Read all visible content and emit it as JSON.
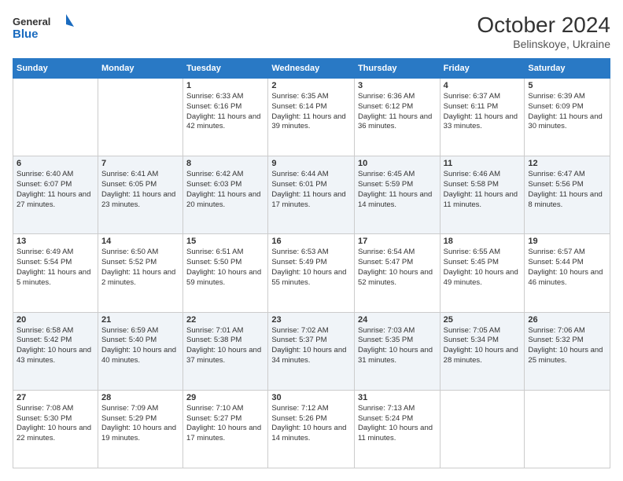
{
  "logo": {
    "general": "General",
    "blue": "Blue"
  },
  "header": {
    "month_year": "October 2024",
    "location": "Belinskoye, Ukraine"
  },
  "days_of_week": [
    "Sunday",
    "Monday",
    "Tuesday",
    "Wednesday",
    "Thursday",
    "Friday",
    "Saturday"
  ],
  "weeks": [
    [
      {
        "day": "",
        "sunrise": "",
        "sunset": "",
        "daylight": ""
      },
      {
        "day": "",
        "sunrise": "",
        "sunset": "",
        "daylight": ""
      },
      {
        "day": "1",
        "sunrise": "Sunrise: 6:33 AM",
        "sunset": "Sunset: 6:16 PM",
        "daylight": "Daylight: 11 hours and 42 minutes."
      },
      {
        "day": "2",
        "sunrise": "Sunrise: 6:35 AM",
        "sunset": "Sunset: 6:14 PM",
        "daylight": "Daylight: 11 hours and 39 minutes."
      },
      {
        "day": "3",
        "sunrise": "Sunrise: 6:36 AM",
        "sunset": "Sunset: 6:12 PM",
        "daylight": "Daylight: 11 hours and 36 minutes."
      },
      {
        "day": "4",
        "sunrise": "Sunrise: 6:37 AM",
        "sunset": "Sunset: 6:11 PM",
        "daylight": "Daylight: 11 hours and 33 minutes."
      },
      {
        "day": "5",
        "sunrise": "Sunrise: 6:39 AM",
        "sunset": "Sunset: 6:09 PM",
        "daylight": "Daylight: 11 hours and 30 minutes."
      }
    ],
    [
      {
        "day": "6",
        "sunrise": "Sunrise: 6:40 AM",
        "sunset": "Sunset: 6:07 PM",
        "daylight": "Daylight: 11 hours and 27 minutes."
      },
      {
        "day": "7",
        "sunrise": "Sunrise: 6:41 AM",
        "sunset": "Sunset: 6:05 PM",
        "daylight": "Daylight: 11 hours and 23 minutes."
      },
      {
        "day": "8",
        "sunrise": "Sunrise: 6:42 AM",
        "sunset": "Sunset: 6:03 PM",
        "daylight": "Daylight: 11 hours and 20 minutes."
      },
      {
        "day": "9",
        "sunrise": "Sunrise: 6:44 AM",
        "sunset": "Sunset: 6:01 PM",
        "daylight": "Daylight: 11 hours and 17 minutes."
      },
      {
        "day": "10",
        "sunrise": "Sunrise: 6:45 AM",
        "sunset": "Sunset: 5:59 PM",
        "daylight": "Daylight: 11 hours and 14 minutes."
      },
      {
        "day": "11",
        "sunrise": "Sunrise: 6:46 AM",
        "sunset": "Sunset: 5:58 PM",
        "daylight": "Daylight: 11 hours and 11 minutes."
      },
      {
        "day": "12",
        "sunrise": "Sunrise: 6:47 AM",
        "sunset": "Sunset: 5:56 PM",
        "daylight": "Daylight: 11 hours and 8 minutes."
      }
    ],
    [
      {
        "day": "13",
        "sunrise": "Sunrise: 6:49 AM",
        "sunset": "Sunset: 5:54 PM",
        "daylight": "Daylight: 11 hours and 5 minutes."
      },
      {
        "day": "14",
        "sunrise": "Sunrise: 6:50 AM",
        "sunset": "Sunset: 5:52 PM",
        "daylight": "Daylight: 11 hours and 2 minutes."
      },
      {
        "day": "15",
        "sunrise": "Sunrise: 6:51 AM",
        "sunset": "Sunset: 5:50 PM",
        "daylight": "Daylight: 10 hours and 59 minutes."
      },
      {
        "day": "16",
        "sunrise": "Sunrise: 6:53 AM",
        "sunset": "Sunset: 5:49 PM",
        "daylight": "Daylight: 10 hours and 55 minutes."
      },
      {
        "day": "17",
        "sunrise": "Sunrise: 6:54 AM",
        "sunset": "Sunset: 5:47 PM",
        "daylight": "Daylight: 10 hours and 52 minutes."
      },
      {
        "day": "18",
        "sunrise": "Sunrise: 6:55 AM",
        "sunset": "Sunset: 5:45 PM",
        "daylight": "Daylight: 10 hours and 49 minutes."
      },
      {
        "day": "19",
        "sunrise": "Sunrise: 6:57 AM",
        "sunset": "Sunset: 5:44 PM",
        "daylight": "Daylight: 10 hours and 46 minutes."
      }
    ],
    [
      {
        "day": "20",
        "sunrise": "Sunrise: 6:58 AM",
        "sunset": "Sunset: 5:42 PM",
        "daylight": "Daylight: 10 hours and 43 minutes."
      },
      {
        "day": "21",
        "sunrise": "Sunrise: 6:59 AM",
        "sunset": "Sunset: 5:40 PM",
        "daylight": "Daylight: 10 hours and 40 minutes."
      },
      {
        "day": "22",
        "sunrise": "Sunrise: 7:01 AM",
        "sunset": "Sunset: 5:38 PM",
        "daylight": "Daylight: 10 hours and 37 minutes."
      },
      {
        "day": "23",
        "sunrise": "Sunrise: 7:02 AM",
        "sunset": "Sunset: 5:37 PM",
        "daylight": "Daylight: 10 hours and 34 minutes."
      },
      {
        "day": "24",
        "sunrise": "Sunrise: 7:03 AM",
        "sunset": "Sunset: 5:35 PM",
        "daylight": "Daylight: 10 hours and 31 minutes."
      },
      {
        "day": "25",
        "sunrise": "Sunrise: 7:05 AM",
        "sunset": "Sunset: 5:34 PM",
        "daylight": "Daylight: 10 hours and 28 minutes."
      },
      {
        "day": "26",
        "sunrise": "Sunrise: 7:06 AM",
        "sunset": "Sunset: 5:32 PM",
        "daylight": "Daylight: 10 hours and 25 minutes."
      }
    ],
    [
      {
        "day": "27",
        "sunrise": "Sunrise: 7:08 AM",
        "sunset": "Sunset: 5:30 PM",
        "daylight": "Daylight: 10 hours and 22 minutes."
      },
      {
        "day": "28",
        "sunrise": "Sunrise: 7:09 AM",
        "sunset": "Sunset: 5:29 PM",
        "daylight": "Daylight: 10 hours and 19 minutes."
      },
      {
        "day": "29",
        "sunrise": "Sunrise: 7:10 AM",
        "sunset": "Sunset: 5:27 PM",
        "daylight": "Daylight: 10 hours and 17 minutes."
      },
      {
        "day": "30",
        "sunrise": "Sunrise: 7:12 AM",
        "sunset": "Sunset: 5:26 PM",
        "daylight": "Daylight: 10 hours and 14 minutes."
      },
      {
        "day": "31",
        "sunrise": "Sunrise: 7:13 AM",
        "sunset": "Sunset: 5:24 PM",
        "daylight": "Daylight: 10 hours and 11 minutes."
      },
      {
        "day": "",
        "sunrise": "",
        "sunset": "",
        "daylight": ""
      },
      {
        "day": "",
        "sunrise": "",
        "sunset": "",
        "daylight": ""
      }
    ]
  ]
}
